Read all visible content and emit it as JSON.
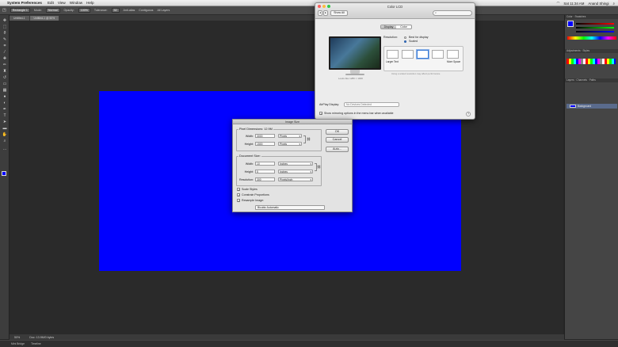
{
  "menubar": {
    "app": "System Preferences",
    "items": [
      "Edit",
      "View",
      "Window",
      "Help"
    ],
    "right": [
      "Sat 11:34 AM",
      "Anand Shingi"
    ]
  },
  "optbar": {
    "preset": "Rectangle 1",
    "mode_label": "Mode:",
    "mode": "Normal",
    "opacity_label": "Opacity:",
    "opacity": "100%",
    "tolerance_label": "Tolerance:",
    "tolerance": "32",
    "antialias": "Anti-alias",
    "contiguous": "Contiguous",
    "all_layers": "All Layers"
  },
  "tabs": [
    "Untitled-1",
    "Untitled-1 @ 50%"
  ],
  "statusbar": {
    "zoom": "50%",
    "doc": "Doc: 13.9M/0 bytes"
  },
  "dock": [
    "Mini Bridge",
    "Timeline"
  ],
  "display_prefs": {
    "title": "Color LCD",
    "show_all": "Show All",
    "search_placeholder": "",
    "tabs": [
      "Display",
      "Color"
    ],
    "resolution_label": "Resolution:",
    "best_for_display": "Best for display",
    "scaled": "Scaled",
    "monitor_caption": "Looks like 1280 × 1000",
    "larger_text": "Larger Text",
    "more_space": "More Space",
    "scaled_note": "Using a scaled resolution may affect performance.",
    "airplay_label": "AirPlay Display:",
    "airplay_value": "No Devices Detected",
    "mirroring": "Show mirroring options in the menu bar when available",
    "help": "?"
  },
  "image_size": {
    "title": "Image Size",
    "pixel_dims_label": "Pixel Dimensions:",
    "pixel_dims_value": "12.9M",
    "width_label": "Width:",
    "height_label": "Height:",
    "pixel_width": "3000",
    "pixel_height": "1500",
    "pixel_unit": "Pixels",
    "doc_size_label": "Document Size:",
    "doc_width": "10",
    "doc_height": "5",
    "doc_unit": "Inches",
    "resolution_label": "Resolution:",
    "resolution": "300",
    "resolution_unit": "Pixels/Inch",
    "ok": "OK",
    "cancel": "Cancel",
    "auto": "Auto...",
    "scale_styles": "Scale Styles",
    "constrain": "Constrain Proportions",
    "resample": "Resample Image:",
    "resample_method": "Bicubic Automatic"
  },
  "colors": {
    "canvas": "#0000ff",
    "workspace": "#2a2a2a",
    "foreground": "#0000ff"
  },
  "panels": {
    "color": "Color",
    "swatches": "Swatches",
    "adjustments": "Adjustments",
    "styles": "Styles",
    "layers": "Layers",
    "channels": "Channels",
    "paths": "Paths",
    "background_layer": "Background"
  }
}
